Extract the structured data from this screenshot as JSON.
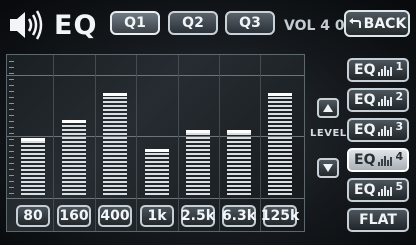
{
  "header": {
    "title": "EQ",
    "presets": [
      "Q1",
      "Q2",
      "Q3"
    ],
    "selected_preset": "Q1",
    "volume_text": "VOL 4 0",
    "back_label": "BACK"
  },
  "eq": {
    "bands": [
      {
        "freq": "80",
        "level": 0.43
      },
      {
        "freq": "160",
        "level": 0.57
      },
      {
        "freq": "400",
        "level": 0.77
      },
      {
        "freq": "1k",
        "level": 0.35
      },
      {
        "freq": "2.5k",
        "level": 0.49
      },
      {
        "freq": "6.3k",
        "level": 0.49
      },
      {
        "freq": "125k",
        "level": 0.77
      }
    ]
  },
  "level_label": "LEVEL",
  "memory": {
    "items": [
      {
        "label": "EQ",
        "num": "1"
      },
      {
        "label": "EQ",
        "num": "2"
      },
      {
        "label": "EQ",
        "num": "3"
      },
      {
        "label": "EQ",
        "num": "4",
        "selected": true
      },
      {
        "label": "EQ",
        "num": "5"
      }
    ],
    "flat_label": "FLAT"
  },
  "icons": {
    "speaker": "speaker-icon",
    "back": "back-arrow-icon",
    "up": "arrow-up-icon",
    "down": "arrow-down-icon",
    "mini_eq": "mini-eq-icon"
  },
  "colors": {
    "bar": "#d8dee2",
    "selected_mem": "#c9d0d5"
  }
}
